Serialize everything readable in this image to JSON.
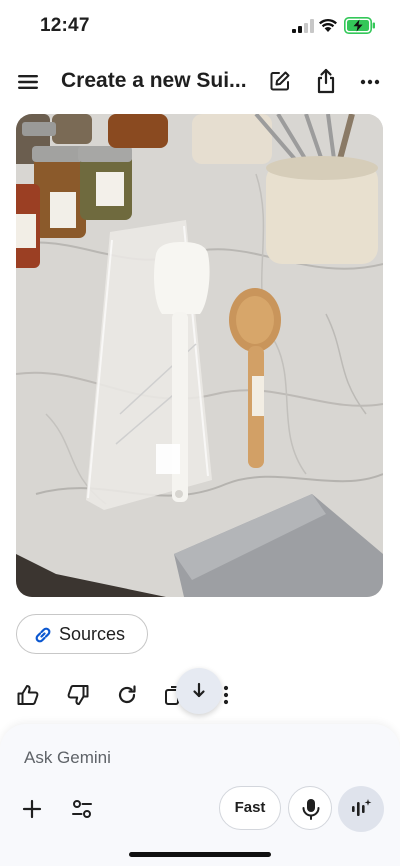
{
  "status_bar": {
    "time": "12:47",
    "icons": [
      "signal-icon",
      "wifi-icon",
      "battery-charging-icon"
    ],
    "battery_color": "#34c759"
  },
  "header": {
    "title": "Create a new Sui...",
    "icons": [
      "menu-icon",
      "edit-icon",
      "share-icon",
      "more-horizontal-icon"
    ]
  },
  "message": {
    "image_alt": "Photo of a white spatula in a plastic bag and a wooden spoon on a marble countertop",
    "sources_label": "Sources",
    "actions": [
      "thumbs-up-icon",
      "thumbs-down-icon",
      "redo-icon",
      "copy-icon",
      "more-vertical-icon"
    ]
  },
  "composer": {
    "placeholder": "Ask Gemini",
    "fast_label": "Fast",
    "icons": [
      "plus-icon",
      "tools-icon",
      "mic-icon",
      "live-icon"
    ]
  },
  "colors": {
    "link_accent": "#0b57d0",
    "panel_background": "#f8f9fc"
  }
}
